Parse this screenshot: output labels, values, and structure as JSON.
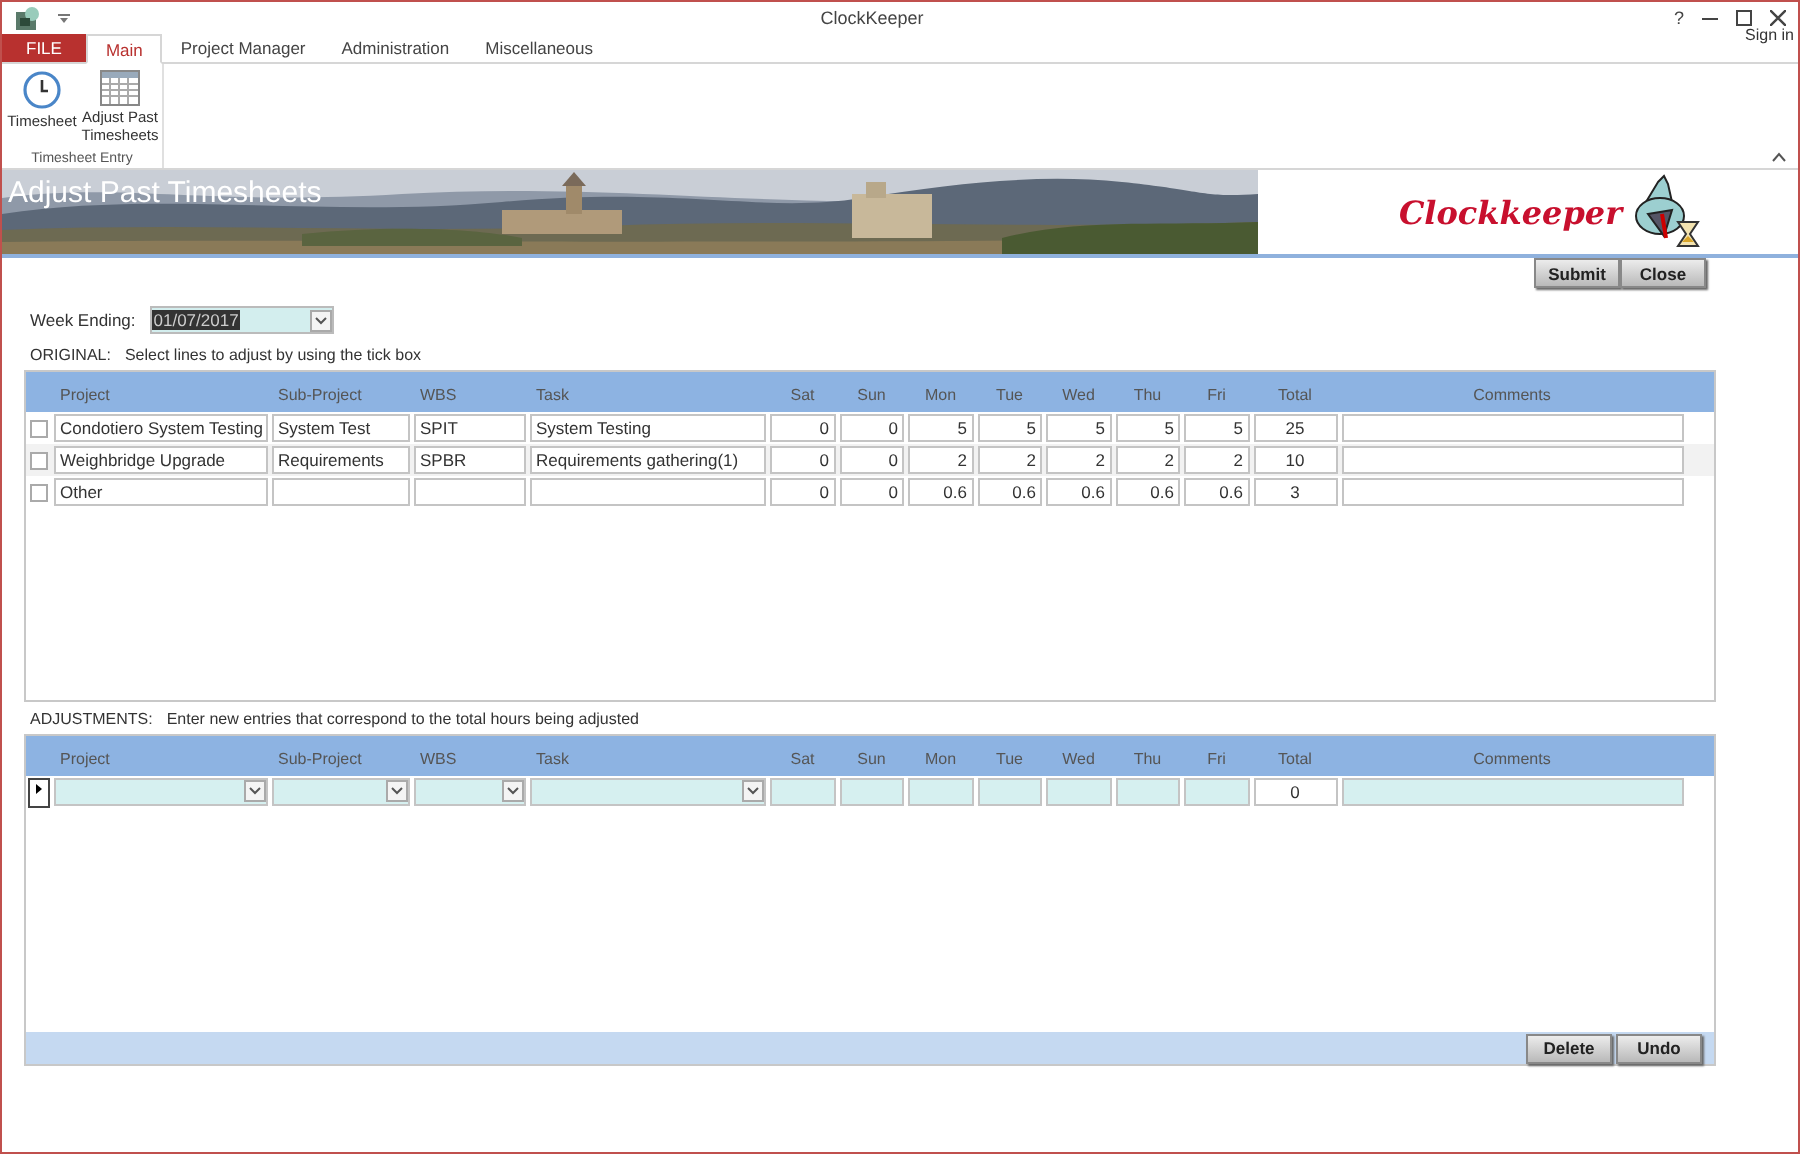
{
  "window": {
    "title": "ClockKeeper",
    "help": "?",
    "sign_in": "Sign in"
  },
  "tabs": [
    {
      "label": "FILE",
      "kind": "file",
      "selected": false
    },
    {
      "label": "Main",
      "kind": "tab",
      "selected": true
    },
    {
      "label": "Project Manager",
      "kind": "tab",
      "selected": false
    },
    {
      "label": "Administration",
      "kind": "tab",
      "selected": false
    },
    {
      "label": "Miscellaneous",
      "kind": "tab",
      "selected": false
    }
  ],
  "ribbon": {
    "buttons": [
      {
        "label": "Timesheet",
        "kind": "clock"
      },
      {
        "label": "Adjust Past Timesheets",
        "kind": "grid"
      }
    ],
    "group": "Timesheet Entry"
  },
  "banner": {
    "title": "Adjust Past Timesheets",
    "logo": "Clockkeeper"
  },
  "actions": [
    "Submit",
    "Close"
  ],
  "week_ending": {
    "label": "Week Ending:",
    "value": "01/07/2017",
    "highlighted": true
  },
  "original": {
    "label": "ORIGINAL:",
    "hint": "Select lines to adjust by using the tick box",
    "columns": [
      "Project",
      "Sub-Project",
      "WBS",
      "Task",
      "Sat",
      "Sun",
      "Mon",
      "Tue",
      "Wed",
      "Thu",
      "Fri",
      "Total",
      "Comments"
    ],
    "rows": [
      {
        "checked": false,
        "project": "Condotiero System Testing",
        "sub_project": "System Test",
        "wbs": "SPIT",
        "task": "System Testing",
        "hours": [
          "0",
          "0",
          "5",
          "5",
          "5",
          "5",
          "5"
        ],
        "total": "25"
      },
      {
        "checked": false,
        "project": "Weighbridge Upgrade",
        "sub_project": "Requirements",
        "wbs": "SPBR",
        "task": "Requirements gathering(1)",
        "hours": [
          "0",
          "0",
          "2",
          "2",
          "2",
          "2",
          "2"
        ],
        "total": "10"
      },
      {
        "checked": false,
        "project": "Other",
        "hours": [
          "0",
          "0",
          "0.6",
          "0.6",
          "0.6",
          "0.6",
          "0.6"
        ],
        "total": "3"
      }
    ]
  },
  "adjustments": {
    "label": "ADJUSTMENTS:",
    "hint": "Enter new entries that correspond to the total hours being adjusted",
    "columns": [
      "Project",
      "Sub-Project",
      "WBS",
      "Task",
      "Sat",
      "Sun",
      "Mon",
      "Tue",
      "Wed",
      "Thu",
      "Fri",
      "Total",
      "Comments"
    ],
    "new_row": {
      "total": "0"
    },
    "buttons": [
      "Delete",
      "Undo"
    ]
  }
}
